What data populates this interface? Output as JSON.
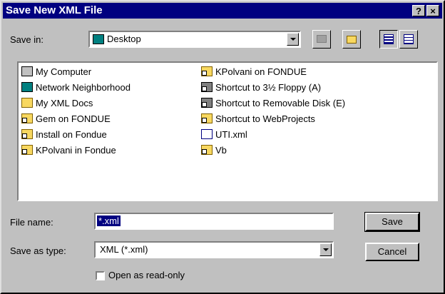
{
  "title": "Save New XML File",
  "titlebar_buttons": {
    "help": "?",
    "close": "×"
  },
  "save_in": {
    "label": "Save in:",
    "value": "Desktop",
    "value_icon": "desktop-icon"
  },
  "toolbar": {
    "up_icon": "up-one-level-icon",
    "new_folder_icon": "new-folder-icon",
    "list_icon": "list-view-icon",
    "details_icon": "details-view-icon"
  },
  "files": [
    {
      "label": "My Computer",
      "icon": "my-computer-icon"
    },
    {
      "label": "Network Neighborhood",
      "icon": "network-neighborhood-icon"
    },
    {
      "label": "My XML Docs",
      "icon": "folder-icon"
    },
    {
      "label": "Gem on FONDUE",
      "icon": "shortcut-folder-icon"
    },
    {
      "label": "Install on Fondue",
      "icon": "shortcut-folder-icon"
    },
    {
      "label": "KPolvani in Fondue",
      "icon": "shortcut-folder-icon"
    },
    {
      "label": "KPolvani on FONDUE",
      "icon": "shortcut-folder-icon"
    },
    {
      "label": "Shortcut to 3½ Floppy (A)",
      "icon": "shortcut-floppy-icon"
    },
    {
      "label": "Shortcut to Removable Disk (E)",
      "icon": "shortcut-drive-icon"
    },
    {
      "label": "Shortcut to WebProjects",
      "icon": "shortcut-folder-icon"
    },
    {
      "label": "UTI.xml",
      "icon": "xml-file-icon"
    },
    {
      "label": "Vb",
      "icon": "shortcut-folder-icon"
    }
  ],
  "file_name": {
    "label": "File name:",
    "value": "*.xml"
  },
  "save_as_type": {
    "label": "Save as type:",
    "value": "XML (*.xml)"
  },
  "buttons": {
    "save": "Save",
    "cancel": "Cancel"
  },
  "read_only": {
    "label": "Open as read-only",
    "checked": false
  }
}
